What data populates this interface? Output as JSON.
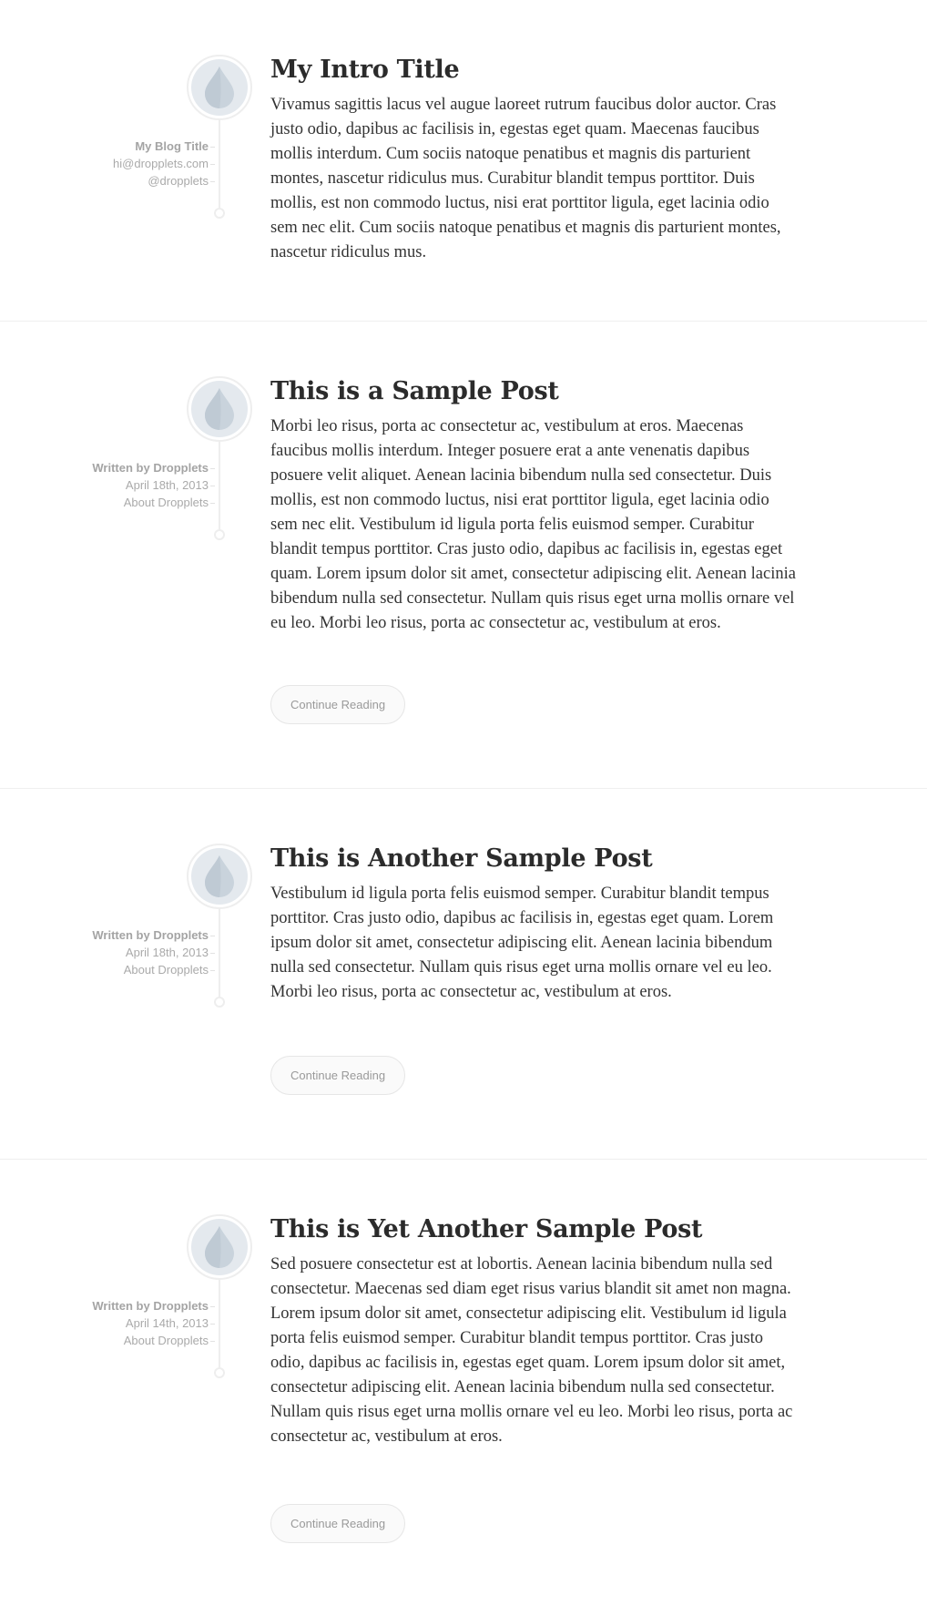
{
  "intro": {
    "title": "My Intro Title",
    "meta": [
      "My Blog Title",
      "hi@dropplets.com",
      "@dropplets"
    ],
    "body": "Vivamus sagittis lacus vel augue laoreet rutrum faucibus dolor auctor. Cras justo odio, dapibus ac facilisis in, egestas eget quam. Maecenas faucibus mollis interdum. Cum sociis natoque penatibus et magnis dis parturient montes, nascetur ridiculus mus. Curabitur blandit tempus porttitor. Duis mollis, est non commodo luctus, nisi erat porttitor ligula, eget lacinia odio sem nec elit. Cum sociis natoque penatibus et magnis dis parturient montes, nascetur ridiculus mus."
  },
  "posts": [
    {
      "title": "This is a Sample Post",
      "author": "Written by Dropplets",
      "date": "April 18th, 2013",
      "category": "About Dropplets",
      "body": "Morbi leo risus, porta ac consectetur ac, vestibulum at eros. Maecenas faucibus mollis interdum. Integer posuere erat a ante venenatis dapibus posuere velit aliquet. Aenean lacinia bibendum nulla sed consectetur. Duis mollis, est non commodo luctus, nisi erat porttitor ligula, eget lacinia odio sem nec elit. Vestibulum id ligula porta felis euismod semper. Curabitur blandit tempus porttitor. Cras justo odio, dapibus ac facilisis in, egestas eget quam. Lorem ipsum dolor sit amet, consectetur adipiscing elit. Aenean lacinia bibendum nulla sed consectetur. Nullam quis risus eget urna mollis ornare vel eu leo. Morbi leo risus, porta ac consectetur ac, vestibulum at eros.",
      "button": "Continue Reading"
    },
    {
      "title": "This is Another Sample Post",
      "author": "Written by Dropplets",
      "date": "April 18th, 2013",
      "category": "About Dropplets",
      "body": "Vestibulum id ligula porta felis euismod semper. Curabitur blandit tempus porttitor. Cras justo odio, dapibus ac facilisis in, egestas eget quam. Lorem ipsum dolor sit amet, consectetur adipiscing elit. Aenean lacinia bibendum nulla sed consectetur. Nullam quis risus eget urna mollis ornare vel eu leo. Morbi leo risus, porta ac consectetur ac, vestibulum at eros.",
      "button": "Continue Reading"
    },
    {
      "title": "This is Yet Another Sample Post",
      "author": "Written by Dropplets",
      "date": "April 14th, 2013",
      "category": "About Dropplets",
      "body": "Sed posuere consectetur est at lobortis. Aenean lacinia bibendum nulla sed consectetur. Maecenas sed diam eget risus varius blandit sit amet non magna. Lorem ipsum dolor sit amet, consectetur adipiscing elit. Vestibulum id ligula porta felis euismod semper. Curabitur blandit tempus porttitor. Cras justo odio, dapibus ac facilisis in, egestas eget quam. Lorem ipsum dolor sit amet, consectetur adipiscing elit. Aenean lacinia bibendum nulla sed consectetur. Nullam quis risus eget urna mollis ornare vel eu leo. Morbi leo risus, porta ac consectetur ac, vestibulum at eros.",
      "button": "Continue Reading"
    }
  ],
  "icons": {
    "avatar": "droplet-icon"
  },
  "colors": {
    "avatar_fill": "#e4e9ee",
    "droplet": "#c9d3dc",
    "divider": "#efefef",
    "meta_text": "#aaaaaa"
  }
}
